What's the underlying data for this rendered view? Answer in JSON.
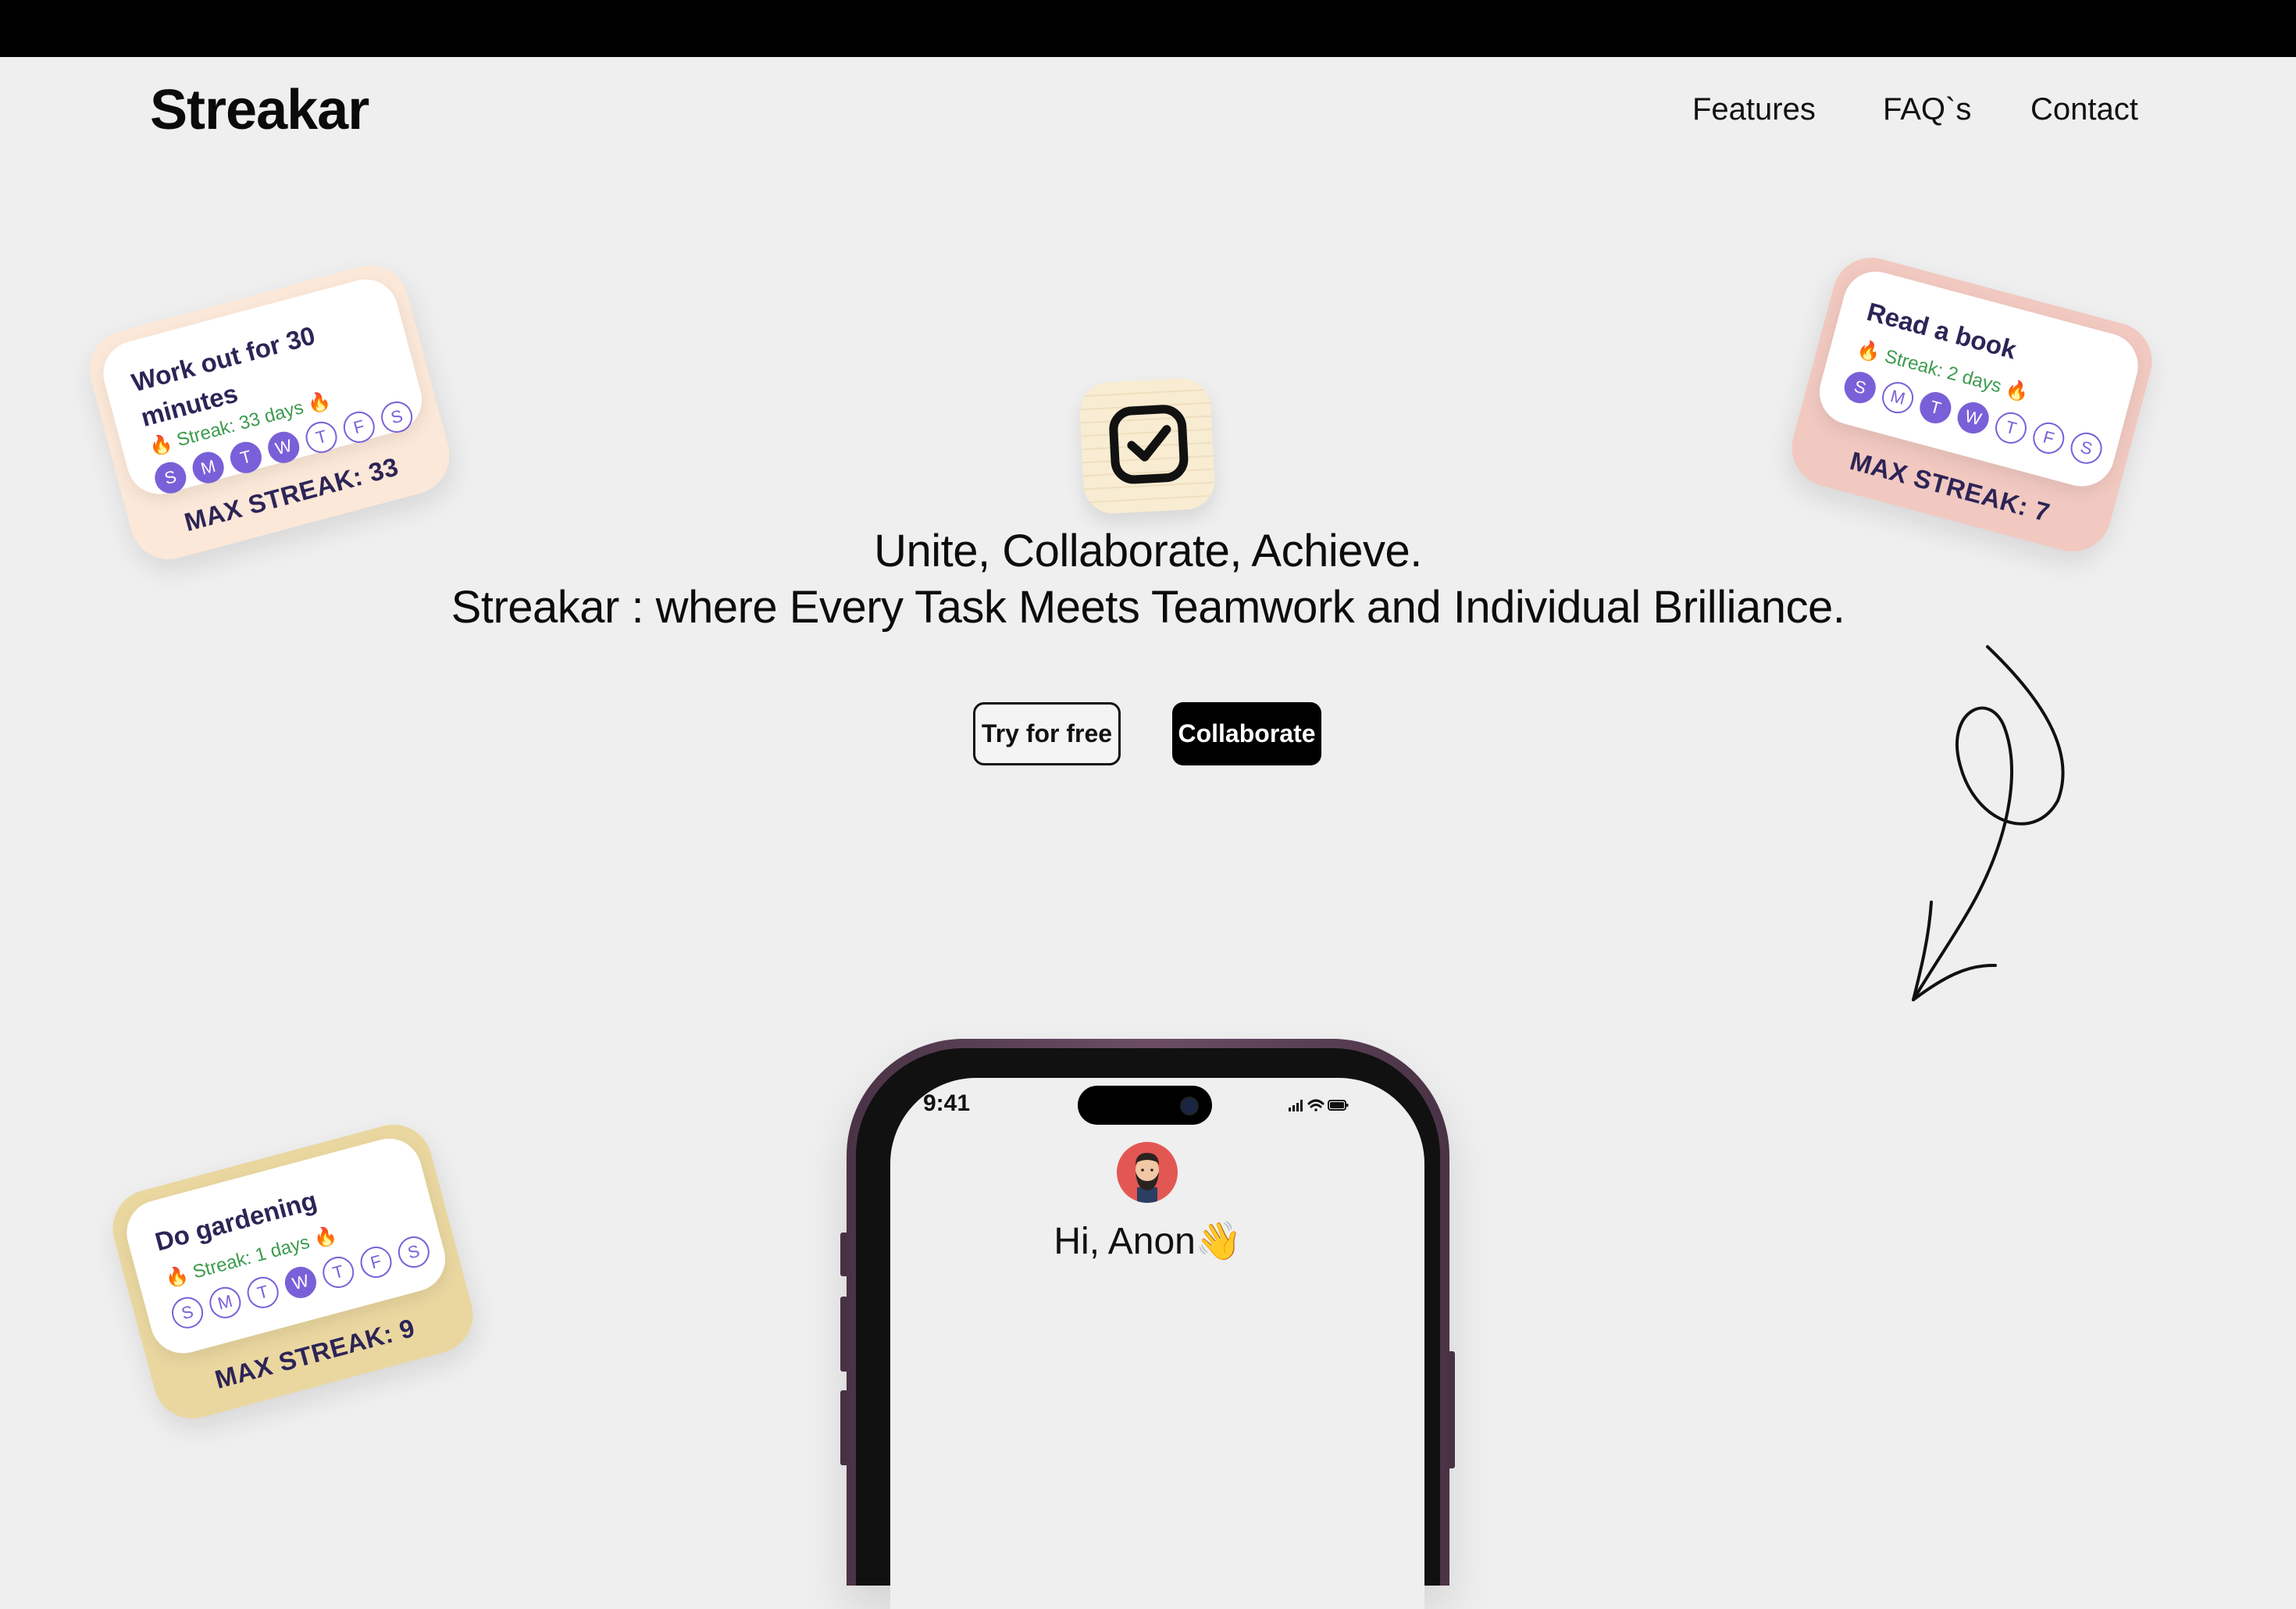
{
  "brand": "Streakar",
  "nav": [
    "Features",
    "FAQ`s",
    "Contact"
  ],
  "hero": {
    "icon": "checkbox-icon",
    "line1": "Unite, Collaborate, Achieve.",
    "line2": "Streakar : where Every Task Meets Teamwork and Individual Brilliance.",
    "try_label": "Try for free",
    "collab_label": "Collaborate"
  },
  "cards": [
    {
      "title": "Work out for 30 minutes",
      "streak": "Streak: 33 days",
      "days": [
        "S",
        "M",
        "T",
        "W",
        "T",
        "F",
        "S"
      ],
      "active": [
        true,
        true,
        true,
        true,
        false,
        false,
        false
      ],
      "max": "MAX STREAK: 33",
      "color": "#fbe8d8"
    },
    {
      "title": "Read a book",
      "streak": "Streak: 2 days",
      "days": [
        "S",
        "M",
        "T",
        "W",
        "T",
        "F",
        "S"
      ],
      "active": [
        true,
        false,
        true,
        true,
        false,
        false,
        false
      ],
      "max": "MAX STREAK: 7",
      "color": "#f1c9c1"
    },
    {
      "title": "Do gardening",
      "streak": "Streak: 1 days",
      "days": [
        "S",
        "M",
        "T",
        "W",
        "T",
        "F",
        "S"
      ],
      "active": [
        false,
        false,
        false,
        true,
        false,
        false,
        false
      ],
      "max": "MAX STREAK: 9",
      "color": "#ead7a0"
    }
  ],
  "phone": {
    "time": "9:41",
    "greeting": "Hi, Anon👋",
    "status_icons": [
      "signal-icon",
      "wifi-icon",
      "battery-icon"
    ]
  },
  "colors": {
    "accent": "#7a60d8",
    "streak": "#3c9a4e",
    "card_text": "#2d2456"
  }
}
